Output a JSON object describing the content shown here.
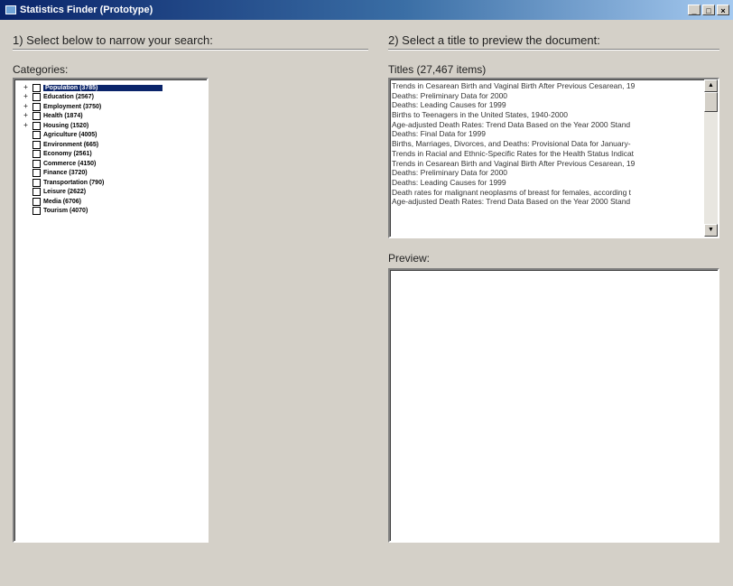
{
  "window": {
    "title": "Statistics Finder (Prototype)",
    "minimize": "_",
    "maximize": "□",
    "close": "×"
  },
  "left": {
    "heading": "1) Select below to narrow your search:",
    "categories_label": "Categories:",
    "categories": [
      {
        "label": "Population (3785)",
        "expandable": true,
        "selected": true
      },
      {
        "label": "Education (2567)",
        "expandable": true
      },
      {
        "label": "Employment (3750)",
        "expandable": true
      },
      {
        "label": "Health (1874)",
        "expandable": true
      },
      {
        "label": "Housing (1520)",
        "expandable": true
      },
      {
        "label": "Agriculture (4005)",
        "expandable": false
      },
      {
        "label": "Environment (665)",
        "expandable": false
      },
      {
        "label": "Economy (2561)",
        "expandable": false
      },
      {
        "label": "Commerce (4150)",
        "expandable": false
      },
      {
        "label": "Finance (3720)",
        "expandable": false
      },
      {
        "label": "Transportation (790)",
        "expandable": false
      },
      {
        "label": "Leisure (2622)",
        "expandable": false
      },
      {
        "label": "Media (6706)",
        "expandable": false
      },
      {
        "label": "Tourism (4070)",
        "expandable": false
      }
    ]
  },
  "right": {
    "heading": "2) Select a title to preview the document:",
    "titles_label": "Titles (27,467 items)",
    "titles": [
      "Trends in Cesarean Birth and Vaginal Birth After Previous Cesarean, 19",
      "Deaths: Preliminary Data for 2000",
      "Deaths: Leading Causes for 1999",
      "Births to Teenagers in the United States, 1940-2000",
      "Age-adjusted Death Rates: Trend Data Based on the Year 2000 Stand",
      "Deaths: Final Data for 1999",
      "Births, Marriages, Divorces, and Deaths: Provisional Data for January-",
      "Trends in Racial and Ethnic-Specific Rates for the Health Status Indicat",
      "Trends in Cesarean Birth and Vaginal Birth After Previous Cesarean, 19",
      "Deaths: Preliminary Data for 2000",
      "Deaths: Leading Causes for 1999",
      "Death rates for malignant neoplasms of breast for females, according t",
      "Age-adjusted Death Rates: Trend Data Based on the Year 2000 Stand"
    ],
    "preview_label": "Preview:"
  }
}
